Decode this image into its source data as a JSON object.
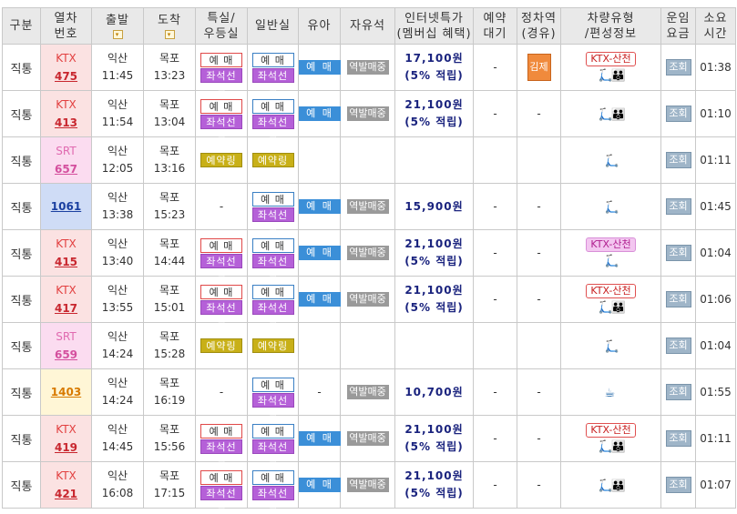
{
  "header": {
    "cols": [
      "구분",
      "열차\n번호",
      "출발",
      "도착",
      "특실/\n우등실",
      "일반실",
      "유아",
      "자유석",
      "인터넷특가\n(멤버십 혜택)",
      "예약\n대기",
      "정차역\n(경유)",
      "차량유형\n/편성정보",
      "운임\n요금",
      "소요\n시간"
    ]
  },
  "rows": [
    {
      "gubun": "직통",
      "type": "KTX",
      "num": "475",
      "kind": "ktx",
      "dep_st": "익산",
      "dep_t": "11:45",
      "arr_st": "목포",
      "arr_t": "13:23",
      "special": [
        "예 매",
        "좌석선택"
      ],
      "special_style": "red",
      "general": [
        "예 매",
        "좌석선택"
      ],
      "yuma": "예 매",
      "free": "역발매중",
      "price1": "17,100원",
      "price2": "(5% 적립)",
      "wait": "-",
      "stop": "김제",
      "cartype": "KTX-산천",
      "cartype_style": "red",
      "icons": [
        "🛴",
        "👪"
      ],
      "fare": "조회",
      "dur": "01:38"
    },
    {
      "gubun": "직통",
      "type": "KTX",
      "num": "413",
      "kind": "ktx",
      "dep_st": "익산",
      "dep_t": "11:54",
      "arr_st": "목포",
      "arr_t": "13:04",
      "special": [
        "예 매",
        "좌석선택"
      ],
      "special_style": "red",
      "general": [
        "예 매",
        "좌석선택"
      ],
      "yuma": "예 매",
      "free": "역발매중",
      "price1": "21,100원",
      "price2": "(5% 적립)",
      "wait": "-",
      "stop": "-",
      "cartype": "",
      "cartype_style": "",
      "icons": [
        "🛴",
        "👪"
      ],
      "fare": "조회",
      "dur": "01:10"
    },
    {
      "gubun": "직통",
      "type": "SRT",
      "num": "657",
      "kind": "srt",
      "dep_st": "익산",
      "dep_t": "12:05",
      "arr_st": "목포",
      "arr_t": "13:16",
      "special": [
        "예약링크"
      ],
      "special_style": "link",
      "general": [
        "예약링크"
      ],
      "general_style": "link",
      "yuma": "",
      "free": "",
      "price1": "",
      "price2": "",
      "wait": "",
      "stop": "",
      "cartype": "",
      "cartype_style": "",
      "icons": [
        "🛴"
      ],
      "fare": "조회",
      "dur": "01:11"
    },
    {
      "gubun": "직통",
      "type": "",
      "num": "1061",
      "kind": "itx",
      "dep_st": "익산",
      "dep_t": "13:38",
      "arr_st": "목포",
      "arr_t": "15:23",
      "special": [
        "-"
      ],
      "special_style": "dash",
      "general": [
        "예 매",
        "좌석선택"
      ],
      "yuma": "예 매",
      "free": "역발매중",
      "price1": "15,900원",
      "price2": "",
      "wait": "-",
      "stop": "-",
      "cartype": "",
      "cartype_style": "",
      "icons": [
        "🛴"
      ],
      "fare": "조회",
      "dur": "01:45"
    },
    {
      "gubun": "직통",
      "type": "KTX",
      "num": "415",
      "kind": "ktx",
      "dep_st": "익산",
      "dep_t": "13:40",
      "arr_st": "목포",
      "arr_t": "14:44",
      "special": [
        "예 매",
        "좌석선택"
      ],
      "special_style": "red",
      "general": [
        "예 매",
        "좌석선택"
      ],
      "yuma": "예 매",
      "free": "역발매중",
      "price1": "21,100원",
      "price2": "(5% 적립)",
      "wait": "-",
      "stop": "-",
      "cartype": "KTX-산천",
      "cartype_style": "pink",
      "icons": [
        "🛴"
      ],
      "fare": "조회",
      "dur": "01:04"
    },
    {
      "gubun": "직통",
      "type": "KTX",
      "num": "417",
      "kind": "ktx",
      "dep_st": "익산",
      "dep_t": "13:55",
      "arr_st": "목포",
      "arr_t": "15:01",
      "special": [
        "예 매",
        "좌석선택"
      ],
      "special_style": "red",
      "general": [
        "예 매",
        "좌석선택"
      ],
      "yuma": "예 매",
      "free": "역발매중",
      "price1": "21,100원",
      "price2": "(5% 적립)",
      "wait": "-",
      "stop": "-",
      "cartype": "KTX-산천",
      "cartype_style": "red",
      "icons": [
        "🛴",
        "👪"
      ],
      "fare": "조회",
      "dur": "01:06"
    },
    {
      "gubun": "직통",
      "type": "SRT",
      "num": "659",
      "kind": "srt",
      "dep_st": "익산",
      "dep_t": "14:24",
      "arr_st": "목포",
      "arr_t": "15:28",
      "special": [
        "예약링크"
      ],
      "special_style": "link",
      "general": [
        "예약링크"
      ],
      "general_style": "link",
      "yuma": "",
      "free": "",
      "price1": "",
      "price2": "",
      "wait": "",
      "stop": "",
      "cartype": "",
      "cartype_style": "",
      "icons": [
        "🛴"
      ],
      "fare": "조회",
      "dur": "01:04"
    },
    {
      "gubun": "직통",
      "type": "",
      "num": "1403",
      "kind": "mug",
      "dep_st": "익산",
      "dep_t": "14:24",
      "arr_st": "목포",
      "arr_t": "16:19",
      "special": [
        "-"
      ],
      "special_style": "dash",
      "general": [
        "예 매",
        "좌석선택"
      ],
      "yuma": "-",
      "yuma_style": "dash",
      "free": "역발매중",
      "price1": "10,700원",
      "price2": "",
      "wait": "-",
      "stop": "-",
      "cartype": "",
      "cartype_style": "",
      "icons": [
        "☕"
      ],
      "fare": "조회",
      "dur": "01:55"
    },
    {
      "gubun": "직통",
      "type": "KTX",
      "num": "419",
      "kind": "ktx",
      "dep_st": "익산",
      "dep_t": "14:45",
      "arr_st": "목포",
      "arr_t": "15:56",
      "special": [
        "예 매",
        "좌석선택"
      ],
      "special_style": "red",
      "general": [
        "예 매",
        "좌석선택"
      ],
      "yuma": "예 매",
      "free": "역발매중",
      "price1": "21,100원",
      "price2": "(5% 적립)",
      "wait": "-",
      "stop": "-",
      "cartype": "KTX-산천",
      "cartype_style": "red",
      "icons": [
        "🛴",
        "👪"
      ],
      "fare": "조회",
      "dur": "01:11"
    },
    {
      "gubun": "직통",
      "type": "KTX",
      "num": "421",
      "kind": "ktx",
      "dep_st": "익산",
      "dep_t": "16:08",
      "arr_st": "목포",
      "arr_t": "17:15",
      "special": [
        "예 매",
        "좌석선택"
      ],
      "special_style": "red",
      "general": [
        "예 매",
        "좌석선택"
      ],
      "yuma": "예 매",
      "free": "역발매중",
      "price1": "21,100원",
      "price2": "(5% 적립)",
      "wait": "-",
      "stop": "-",
      "cartype": "",
      "cartype_style": "",
      "icons": [
        "🛴",
        "👪"
      ],
      "fare": "조회",
      "dur": "01:07"
    }
  ]
}
